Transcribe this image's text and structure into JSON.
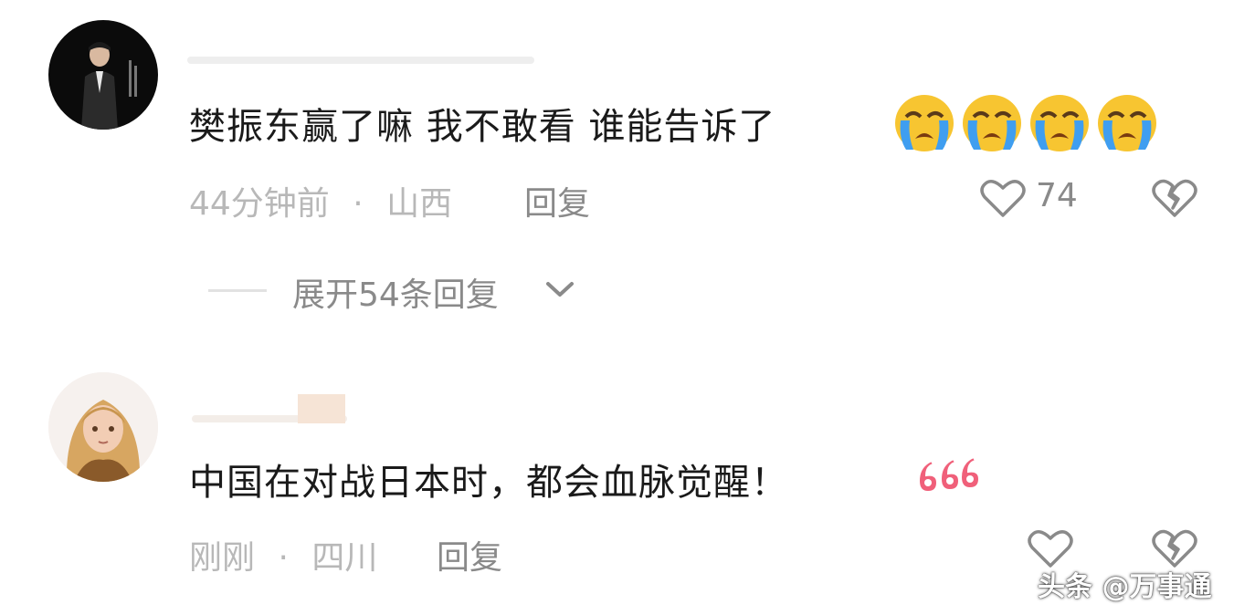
{
  "comments": [
    {
      "text": "樊振东赢了嘛 我不敢看 谁能告诉了",
      "emoji": [
        "loudly-crying-face",
        "loudly-crying-face",
        "loudly-crying-face",
        "loudly-crying-face"
      ],
      "time": "44分钟前",
      "separator": "·",
      "location": "山西",
      "reply_label": "回复",
      "like_count": "74",
      "expand_replies_label": "展开54条回复"
    },
    {
      "text": "中国在对战日本时，都会血脉觉醒！",
      "emoji": [
        "666-sticker"
      ],
      "time": "刚刚",
      "separator": "·",
      "location": "四川",
      "reply_label": "回复"
    }
  ],
  "watermark": "头条 @万事通",
  "colors": {
    "text_primary": "#1a1a1a",
    "text_meta": "#b8b8b8",
    "text_action": "#8a8a8a",
    "emoji_face": "#f7c531",
    "emoji_tears": "#3f9ef0",
    "sticker_pink": "#f0607a"
  }
}
